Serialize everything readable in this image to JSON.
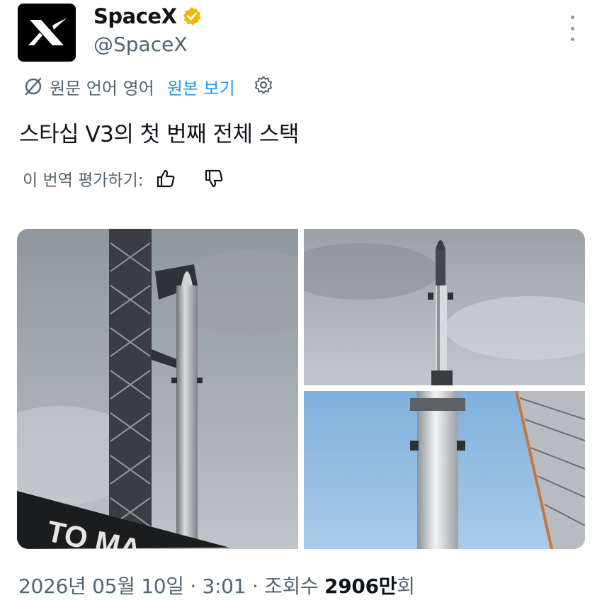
{
  "author": {
    "name": "SpaceX",
    "handle": "@SpaceX",
    "verified": true,
    "badge_color": "#f4b400"
  },
  "translation": {
    "source_language": "원문 언어 영어",
    "show_original": "원본 보기",
    "link_color": "#1d9bf0"
  },
  "tweet": {
    "text": "스타십 V3의 첫 번째 전체 스택"
  },
  "rating": {
    "label": "이 번역 평가하기:"
  },
  "media": {
    "images": [
      {
        "icon": "rocket-tower-photo"
      },
      {
        "icon": "rocket-stack-photo"
      },
      {
        "icon": "booster-closeup-photo"
      }
    ],
    "sign_text": "TO MA"
  },
  "footer": {
    "date": "2026년 05월 10일",
    "time": "3:01",
    "views_label": "조회수",
    "views_count": "2906만",
    "views_suffix": "회"
  }
}
